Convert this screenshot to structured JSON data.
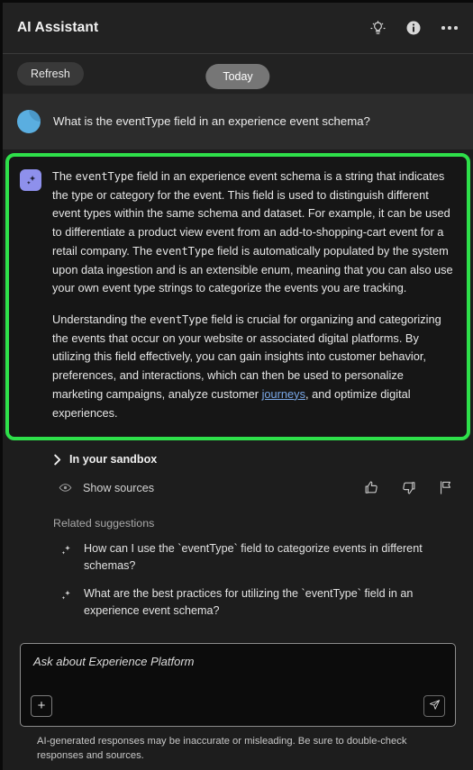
{
  "header": {
    "title": "AI Assistant",
    "icons": [
      {
        "name": "lightbulb-icon",
        "label": "Ideas"
      },
      {
        "name": "info-icon",
        "label": "Information"
      },
      {
        "name": "more-options-icon",
        "label": "More options"
      }
    ]
  },
  "toolbar": {
    "refresh_label": "Refresh",
    "today_label": "Today"
  },
  "conversation": {
    "user": {
      "avatar": "user-avatar",
      "text": "What is the eventType field in an experience event schema?"
    },
    "assistant": {
      "highlight_color": "#2ee04a",
      "icon": "ai-sparkle-icon",
      "paragraph1": {
        "p1": "The ",
        "code1": "eventType",
        "p2": " field in an experience event schema is a string that indicates the type or category for the event. This field is used to distinguish different event types within the same schema and dataset. For example, it can be used to differentiate a product view event from an add-to-shopping-cart event for a retail company. The ",
        "code2": "eventType",
        "p3": " field is automatically populated by the system upon data ingestion and is an extensible enum, meaning that you can also use your own event type strings to categorize the events you are tracking."
      },
      "paragraph2": {
        "p1": "Understanding the ",
        "code1": "eventType",
        "p2": " field is crucial for organizing and categorizing the events that occur on your website or associated digital platforms. By utilizing this field effectively, you can gain insights into customer behavior, preferences, and interactions, which can then be used to personalize marketing campaigns, analyze customer ",
        "link": "journeys",
        "p3": ", and optimize digital experiences."
      }
    }
  },
  "sandbox": {
    "label": "In your sandbox"
  },
  "sources": {
    "label": "Show sources",
    "feedback": [
      {
        "name": "thumbs-up-icon",
        "label": "Helpful"
      },
      {
        "name": "thumbs-down-icon",
        "label": "Not helpful"
      },
      {
        "name": "flag-icon",
        "label": "Report"
      }
    ]
  },
  "related": {
    "title": "Related suggestions",
    "items": [
      {
        "text": "How can I use the `eventType` field to categorize events in different schemas?"
      },
      {
        "text": "What are the best practices for utilizing the `eventType` field in an experience event schema?"
      }
    ]
  },
  "composer": {
    "placeholder": "Ask about Experience Platform",
    "value": "",
    "add_label": "+",
    "send_label": "send-icon",
    "disclaimer": "AI-generated responses may be inaccurate or misleading. Be sure to double-check responses and sources."
  }
}
